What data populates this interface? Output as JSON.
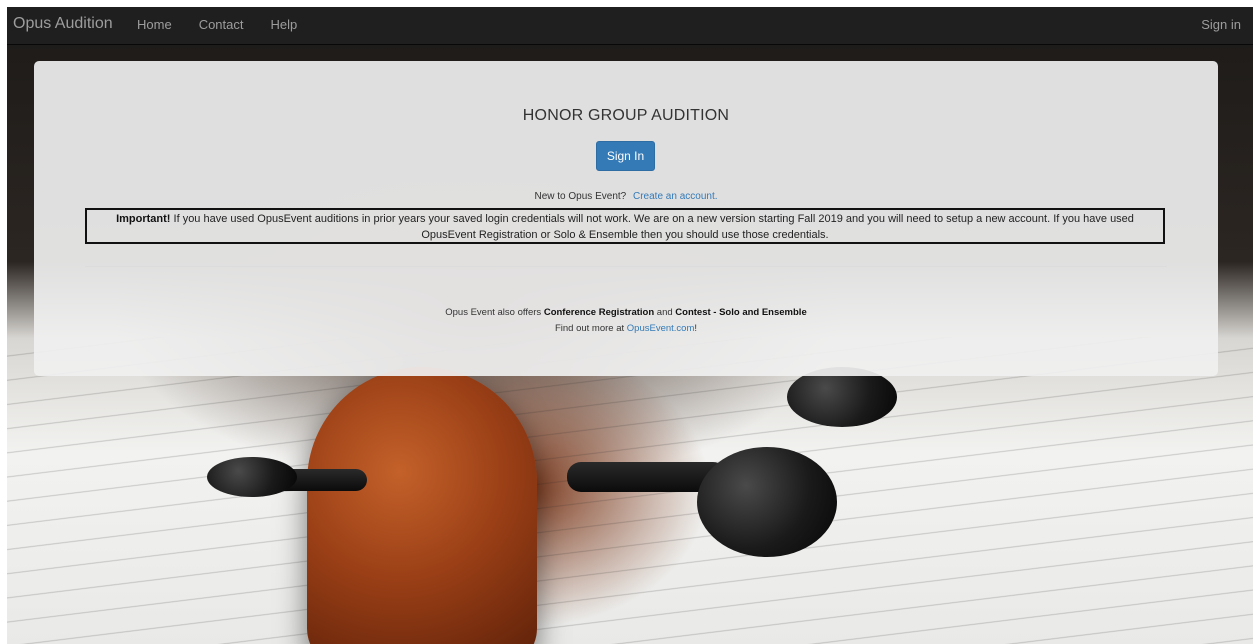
{
  "navbar": {
    "brand": "Opus Audition",
    "links": [
      "Home",
      "Contact",
      "Help"
    ],
    "signin": "Sign in"
  },
  "panel": {
    "title": "HONOR GROUP AUDITION",
    "signin_button": "Sign In",
    "new_prompt": "New to Opus Event?",
    "create_account_link": "Create an account.",
    "important_label": "Important!",
    "important_text": " If you have used OpusEvent auditions in prior years your saved login credentials will not work. We are on a new version starting Fall 2019 and you will need to setup a new account. If you have used OpusEvent Registration or Solo & Ensemble then you should use those credentials.",
    "offers_prefix": "Opus Event also offers ",
    "offers_item1": "Conference Registration",
    "offers_and": " and ",
    "offers_item2": "Contest - Solo and Ensemble",
    "find_prefix": "Find out more at ",
    "find_link": "OpusEvent.com",
    "find_suffix": "!"
  },
  "colors": {
    "navbar_bg": "#1f1f1f",
    "nav_text": "#9d9d9d",
    "primary_button": "#337ab7",
    "link": "#337ab7"
  }
}
